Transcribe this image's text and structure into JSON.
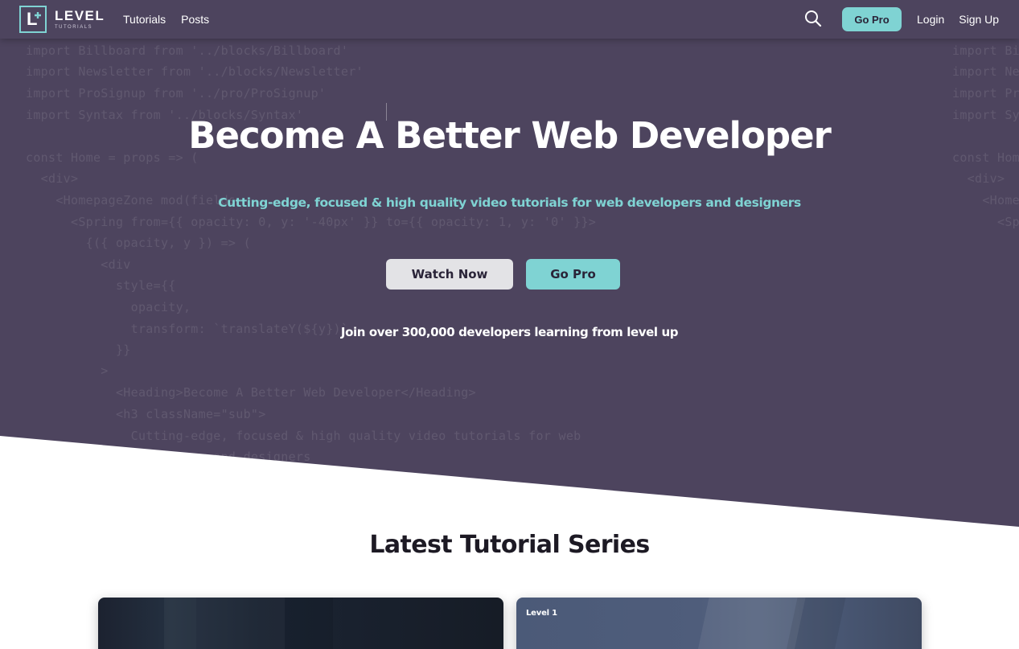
{
  "nav": {
    "logo_word": "LEVEL",
    "logo_sub": "TUTORIALS",
    "links": [
      "Tutorials",
      "Posts"
    ],
    "search_icon": "search-icon",
    "go_pro_label": "Go Pro",
    "login_label": "Login",
    "signup_label": "Sign Up"
  },
  "hero": {
    "title": "Become A Better Web Developer",
    "subtitle": "Cutting-edge, focused & high quality video tutorials for web developers and designers",
    "watch_label": "Watch Now",
    "gopro_label": "Go Pro",
    "join_text": "Join over 300,000 developers learning from level up"
  },
  "code_background": [
    "import Billboard from '../blocks/Billboard'",
    "import Newsletter from '../blocks/Newsletter'",
    "import ProSignup from '../pro/ProSignup'",
    "import Syntax from '../blocks/Syntax'",
    "",
    "const Home = props => (",
    "  <div>",
    "    <HomepageZone mod(fields",
    "      <Spring from={{ opacity: 0, y: '-40px' }} to={{ opacity: 1, y: '0' }}>",
    "        {({ opacity, y }) => (",
    "          <div",
    "            style={{",
    "              opacity,",
    "              transform: `translateY(${y})`",
    "            }}",
    "          >",
    "            <Heading>Become A Better Web Developer</Heading>",
    "            <h3 className=\"sub\">",
    "              Cutting-edge, focused & high quality video tutorials for web",
    "              developers and designers"
  ],
  "code_background_right": [
    "import Bil",
    "import Ne",
    "import Pr",
    "import Sy",
    "",
    "const Home",
    "  <div>",
    "    <Home",
    "      <Sp"
  ],
  "latest": {
    "title": "Latest Tutorial Series",
    "cards": [
      {
        "label": ""
      },
      {
        "label": "Level 1"
      }
    ]
  },
  "colors": {
    "hero_bg": "#4d445e",
    "accent": "#7fd3d3",
    "button_light": "#e3e3e6"
  }
}
